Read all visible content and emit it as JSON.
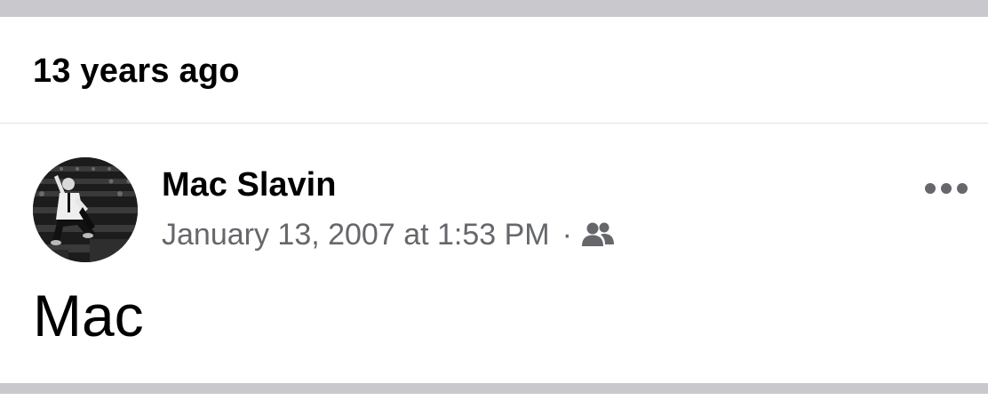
{
  "memory_header": {
    "title": "13 years ago"
  },
  "post": {
    "author": "Mac Slavin",
    "timestamp": "January 13, 2007 at 1:53 PM",
    "separator": "·",
    "audience_icon": "friends-icon",
    "more_icon": "more-icon",
    "text": "Mac"
  },
  "colors": {
    "divider": "#c9c8cd",
    "meta_text": "#65676b",
    "primary_text": "#000000"
  }
}
